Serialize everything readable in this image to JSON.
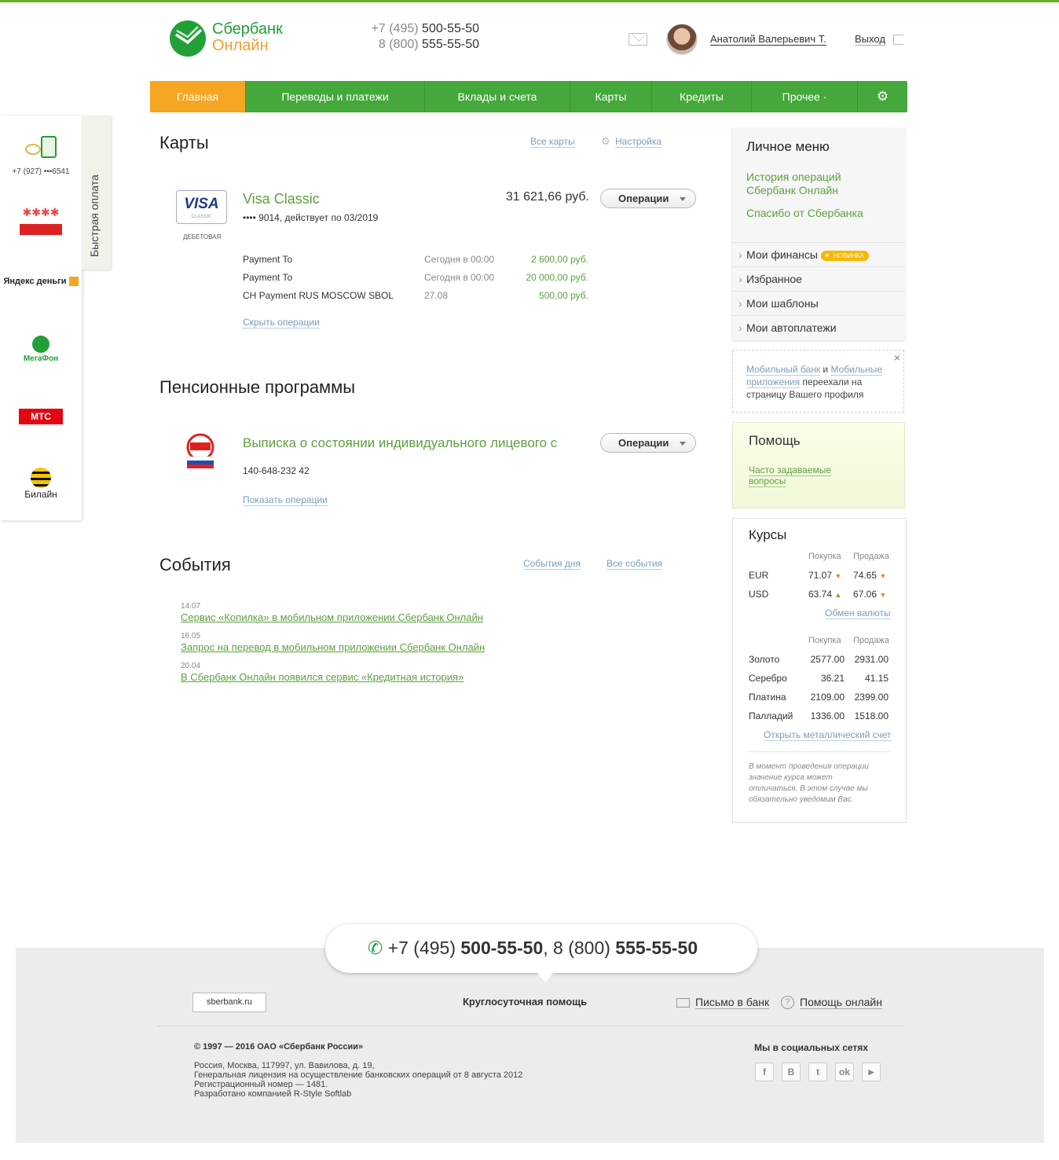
{
  "header": {
    "logo_line1": "Сбербанк",
    "logo_line2": "Онлайн",
    "phone1_prefix": "+7 (495)",
    "phone1": "500-55-50",
    "phone2_prefix": "8 (800)",
    "phone2": "555-55-50",
    "user_name": "Анатолий Валерьевич Т.",
    "logout": "Выход"
  },
  "nav": {
    "items": [
      "Главная",
      "Переводы и платежи",
      "Вклады и счета",
      "Карты",
      "Кредиты",
      "Прочее ·"
    ]
  },
  "sidebar": {
    "tab_label": "Быстрая оплата",
    "phone": "+7 (927) •••6541",
    "yandex": "Яндекс деньги",
    "megafon": "МегаФон",
    "mts": "МТС",
    "beeline": "Билайн"
  },
  "cards": {
    "title": "Карты",
    "all_cards": "Все карты",
    "settings": "Настройка",
    "card_name": "Visa Classic",
    "card_sub": "•••• 9014, действует по 03/2019",
    "balance": "31 621,66 руб.",
    "ops_button": "Операции",
    "visa_logo": "VISA",
    "visa_small": "CLASSIC",
    "card_type": "ДЕБЕТОВАЯ",
    "transactions": [
      {
        "name": "Payment To",
        "date": "Сегодня в 00:00",
        "amount": "2 600,00 руб."
      },
      {
        "name": "Payment To",
        "date": "Сегодня в 00:00",
        "amount": "20 000,00 руб."
      },
      {
        "name": "CH Payment RUS MOSCOW SBOL",
        "date": "27.08",
        "amount": "500,00 руб."
      }
    ],
    "hide_ops": "Скрыть операции"
  },
  "pension": {
    "title": "Пенсионные программы",
    "name": "Выписка о состоянии индивидуального лицевого с",
    "number": "140-648-232 42",
    "ops_button": "Операции",
    "show_ops": "Показать операции"
  },
  "events": {
    "title": "События",
    "day_events": "События дня",
    "all_events": "Все события",
    "items": [
      {
        "date": "14.07",
        "text": "Сервис «Копилка» в мобильном приложении Сбербанк Онлайн"
      },
      {
        "date": "16.05",
        "text": "Запрос на перевод в мобильном приложении Сбербанк Онлайн"
      },
      {
        "date": "20.04",
        "text": "В Сбербанк Онлайн появился сервис «Кредитная история»"
      }
    ]
  },
  "personal": {
    "title": "Личное меню",
    "link1a": "История операций",
    "link1b": "Сбербанк Онлайн",
    "link2": "Спасибо от Сбербанка",
    "finances": "Мои финансы",
    "badge": "НОВИНКА",
    "favorites": "Избранное",
    "templates": "Мои шаблоны",
    "autopay": "Мои автоплатежи"
  },
  "notice": {
    "mb": "Мобильный банк",
    "and": " и ",
    "apps1": "Мобильные",
    "apps2": "приложения",
    "rest1": " переехали на",
    "rest2": "страницу Вашего профиля",
    "close": "×"
  },
  "help": {
    "title": "Помощь",
    "faq1": "Часто задаваемые",
    "faq2": "вопросы"
  },
  "rates": {
    "title": "Курсы",
    "buy": "Покупка",
    "sell": "Продажа",
    "currencies": [
      {
        "code": "EUR",
        "buy": "71.07",
        "sell": "74.65"
      },
      {
        "code": "USD",
        "buy": "63.74",
        "sell": "67.06"
      }
    ],
    "exchange": "Обмен валюты",
    "metals": [
      {
        "name": "Золото",
        "buy": "2577.00",
        "sell": "2931.00"
      },
      {
        "name": "Серебро",
        "buy": "36.21",
        "sell": "41.15"
      },
      {
        "name": "Платина",
        "buy": "2109.00",
        "sell": "2399.00"
      },
      {
        "name": "Палладий",
        "buy": "1336.00",
        "sell": "1518.00"
      }
    ],
    "metal_account": "Открыть металлический счет",
    "note": [
      "В момент проведения операции",
      "значение курса может",
      "отличаться. В этом случае мы",
      "обязательно уведомим Вас."
    ]
  },
  "footer": {
    "call_prefix1": "+7 (495) ",
    "call_num1": "500-55-50",
    "call_sep": ", 8 (800) ",
    "call_num2": "555-55-50",
    "site": "sberbank.ru",
    "support": "Круглосуточная помощь",
    "letter": "Письмо в банк",
    "help_online": "Помощь онлайн",
    "copyright": "© 1997 — 2016 ОАО «Сбербанк России»",
    "addr": "Россия, Москва, 117997, ул. Вавилова, д. 19,",
    "license": "Генеральная лицензия на осуществление банковских операций от 8 августа 2012",
    "reg": "Регистрационный номер — 1481.",
    "dev": "Разработано компанией R-Style Softlab",
    "social": "Мы в социальных сетях"
  },
  "colors": {
    "brand_green": "#21a038",
    "accent_orange": "#f5a623",
    "nav_green": "#45a83a"
  }
}
